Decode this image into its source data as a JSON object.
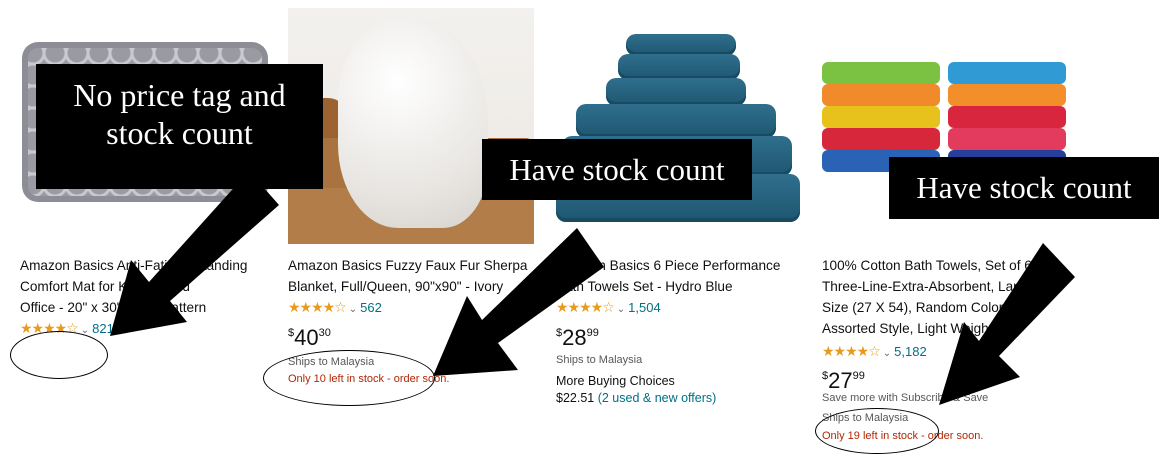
{
  "callouts": {
    "no_price": "No price tag and stock count",
    "stock_1": "Have stock count",
    "stock_2": "Have stock count"
  },
  "products": [
    {
      "title_lines": [
        "Amazon Basics Anti-Fatigue Standing",
        "Comfort Mat for Kitchen and",
        "Office - 20\" x 30\", Gray Pattern"
      ],
      "stars": "★★★★☆",
      "reviews": "821"
    },
    {
      "title_lines": [
        "Amazon Basics Fuzzy Faux Fur Sherpa",
        "Blanket, Full/Queen, 90\"x90\" - Ivory"
      ],
      "stars": "★★★★☆",
      "reviews": "562",
      "price_whole": "40",
      "price_frac": "30",
      "ships": "Ships to Malaysia",
      "stock": "Only 10 left in stock - order soon."
    },
    {
      "title_lines": [
        "Amazon Basics 6 Piece Performance",
        "Bath Towels Set - Hydro Blue"
      ],
      "stars": "★★★★☆",
      "reviews": "1,504",
      "price_whole": "28",
      "price_frac": "99",
      "ships": "Ships to Malaysia",
      "more_label": "More Buying Choices",
      "more_price": "$22.51",
      "more_offers": "(2 used & new offers)"
    },
    {
      "title_lines": [
        "100% Cotton Bath Towels, Set of 6",
        "Three-Line-Extra-Absorbent, Large",
        "Size (27 X 54), Random Color,",
        "Assorted Style, Light Weight..."
      ],
      "stars": "★★★★☆",
      "reviews": "5,182",
      "price_whole": "27",
      "price_frac": "99",
      "subscribe": "Save more with Subscribe & Save",
      "ships": "Ships to Malaysia",
      "stock": "Only 19 left in stock - order soon."
    }
  ],
  "currency": "$",
  "colors": {
    "star": "#e89a1c",
    "link": "#007185",
    "stock": "#b12704"
  }
}
